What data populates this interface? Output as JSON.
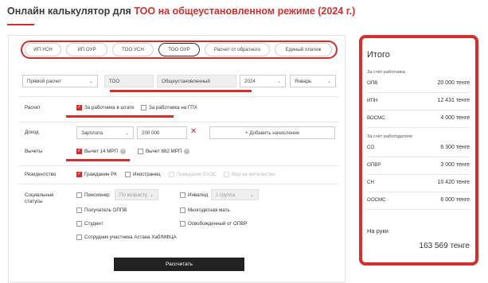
{
  "header": {
    "title_plain": "Онлайн калькулятор для ",
    "title_accent": "ТОО на общеустановленном режиме (2024 г.)"
  },
  "tabs": [
    {
      "label": "ИП УСН",
      "active": false
    },
    {
      "label": "ИП ОУР",
      "active": false
    },
    {
      "label": "ТОО УСН",
      "active": false
    },
    {
      "label": "ТОО ОУР",
      "active": true
    },
    {
      "label": "Расчет от обратного",
      "active": false
    },
    {
      "label": "Единый платеж",
      "active": false
    }
  ],
  "filters": {
    "calc_type": "Прямой расчет",
    "entity": "ТОО",
    "regime": "Общеустановленный",
    "year": "2024",
    "month": "Январь"
  },
  "calculation": {
    "label": "Расчет",
    "option_staff": "За работника в штате",
    "option_gph": "За работника на ГПХ"
  },
  "income": {
    "label": "Доход",
    "type": "Зарплата",
    "amount": "200 000",
    "add_button": "+ Добавить начисление"
  },
  "deductions": {
    "label": "Вычеты",
    "option_14": "Вычет 14 МРП",
    "option_882": "Вычет 882 МРП",
    "info": "?"
  },
  "residency": {
    "label": "Резидентство",
    "options": [
      "Гражданин РК",
      "Иностранец",
      "Гражданин ЕАЭС",
      "Вид на жительство"
    ]
  },
  "social": {
    "label_line1": "Социальные",
    "label_line2": "статусы",
    "pensioner": "Пенсионер",
    "pension_select": "По возрасту",
    "disabled": "Инвалид",
    "disability_select": "1 группа",
    "oppv_recipient": "Получатель ОППВ",
    "large_family": "Многодетная мать",
    "student": "Студент",
    "exempt_opvr": "Освобожденный от ОПВР",
    "astana_hub": "Сотрудник участника Астана Хаб/МФЦА"
  },
  "calculate_button": "Рассчитать",
  "summary": {
    "title": "Итого",
    "employee_heading": "За счёт работника",
    "employee_rows": [
      {
        "key": "ОПВ",
        "value": "20 000 тенге"
      },
      {
        "key": "ИПН",
        "value": "12 431 тенге"
      },
      {
        "key": "ВОСМС",
        "value": "4 000 тенге"
      }
    ],
    "employer_heading": "За счёт работодателя",
    "employer_rows": [
      {
        "key": "СО",
        "value": "6 300 тенге"
      },
      {
        "key": "ОПВР",
        "value": "3 000 тенге"
      },
      {
        "key": "СН",
        "value": "10 420 тенге"
      },
      {
        "key": "ООСМС",
        "value": "6 000 тенге"
      }
    ],
    "take_home_label": "На руки",
    "take_home_value": "163 569 тенге"
  },
  "colors": {
    "accent": "#d32f2f",
    "button_dark": "#222222"
  }
}
